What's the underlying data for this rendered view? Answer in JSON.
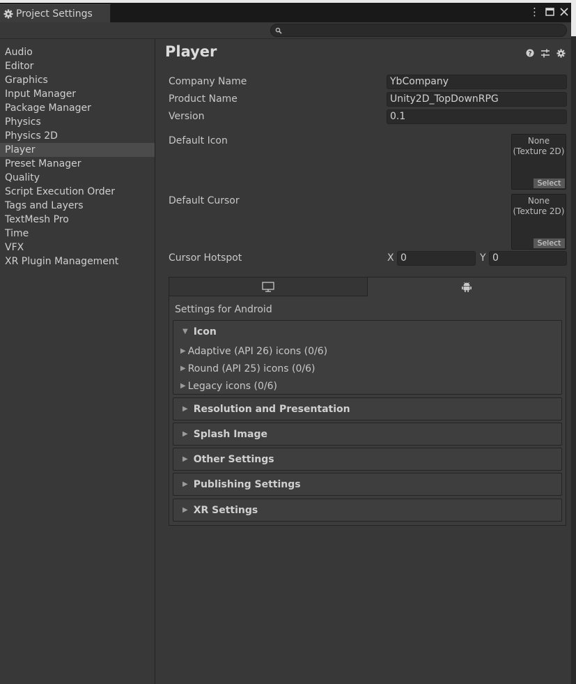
{
  "window": {
    "tab_title": "Project Settings",
    "tab_icon": "gear-icon",
    "controls": [
      "kebab-menu-icon",
      "maximize-icon",
      "close-icon"
    ]
  },
  "search": {
    "placeholder": "",
    "icon": "search-icon"
  },
  "sidebar": {
    "items": [
      {
        "label": "Audio"
      },
      {
        "label": "Editor"
      },
      {
        "label": "Graphics"
      },
      {
        "label": "Input Manager"
      },
      {
        "label": "Package Manager"
      },
      {
        "label": "Physics"
      },
      {
        "label": "Physics 2D"
      },
      {
        "label": "Player",
        "selected": true
      },
      {
        "label": "Preset Manager"
      },
      {
        "label": "Quality"
      },
      {
        "label": "Script Execution Order"
      },
      {
        "label": "Tags and Layers"
      },
      {
        "label": "TextMesh Pro"
      },
      {
        "label": "Time"
      },
      {
        "label": "VFX"
      },
      {
        "label": "XR Plugin Management"
      }
    ]
  },
  "player": {
    "title": "Player",
    "header_icons": [
      "help-icon",
      "preset-icon",
      "settings-gear-icon"
    ],
    "company_name_label": "Company Name",
    "company_name_value": "YbCompany",
    "product_name_label": "Product Name",
    "product_name_value": "Unity2D_TopDownRPG",
    "version_label": "Version",
    "version_value": "0.1",
    "default_icon_label": "Default Icon",
    "default_icon_value": "None",
    "default_icon_type": "(Texture 2D)",
    "default_cursor_label": "Default Cursor",
    "default_cursor_value": "None",
    "default_cursor_type": "(Texture 2D)",
    "select_label": "Select",
    "cursor_hotspot_label": "Cursor Hotspot",
    "hotspot_x_label": "X",
    "hotspot_x_value": "0",
    "hotspot_y_label": "Y",
    "hotspot_y_value": "0"
  },
  "platforms": {
    "tabs": [
      {
        "icon": "monitor-icon",
        "active": false
      },
      {
        "icon": "android-icon",
        "active": true
      }
    ],
    "settings_for": "Settings for Android",
    "icon_section": {
      "title": "Icon",
      "items": [
        "Adaptive (API 26) icons (0/6)",
        "Round (API 25) icons (0/6)",
        "Legacy icons (0/6)"
      ]
    },
    "sections": [
      "Resolution and Presentation",
      "Splash Image",
      "Other Settings",
      "Publishing Settings",
      "XR Settings"
    ]
  }
}
